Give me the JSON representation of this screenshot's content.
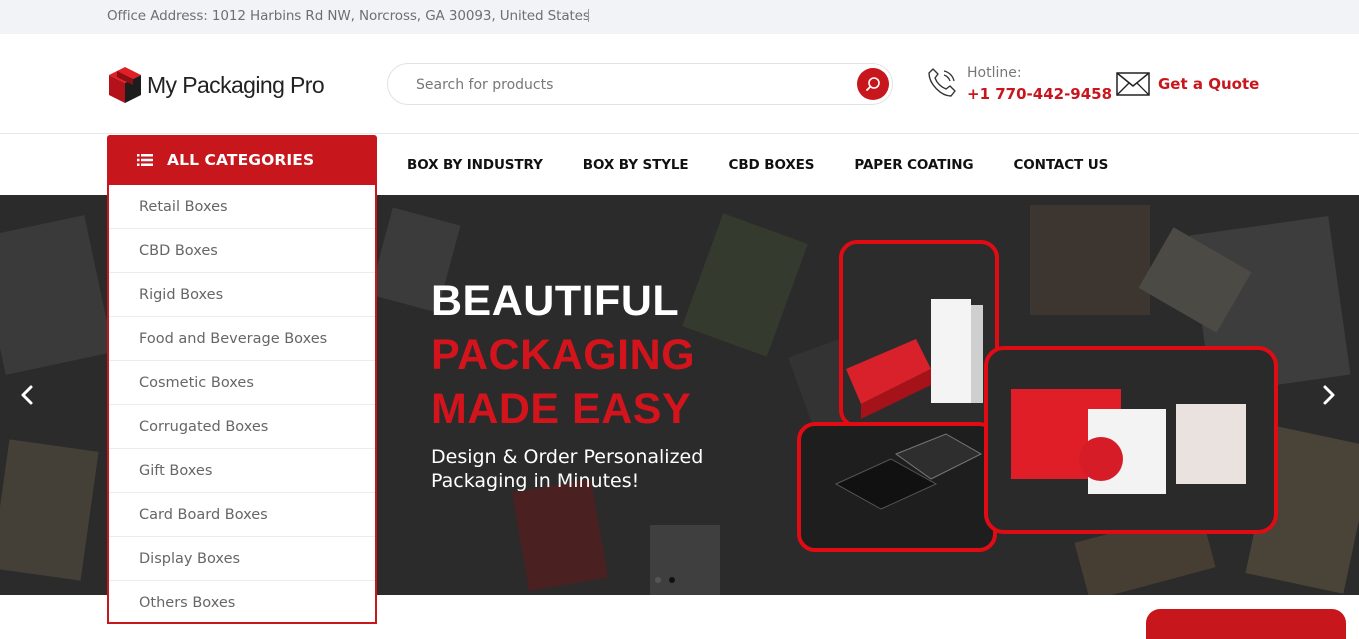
{
  "topbar": {
    "address": "Office Address: 1012 Harbins Rd NW, Norcross, GA 30093, United States"
  },
  "header": {
    "logo_text": "My Packaging Pro",
    "search": {
      "placeholder": "Search for products"
    },
    "hotline": {
      "label": "Hotline:",
      "number": "+1 770-442-9458"
    },
    "quote": {
      "label": "Get a Quote"
    }
  },
  "nav": {
    "items": [
      "BOX BY INDUSTRY",
      "BOX BY STYLE",
      "CBD BOXES",
      "PAPER COATING",
      "CONTACT US"
    ]
  },
  "categories": {
    "title": "ALL CATEGORIES",
    "items": [
      "Retail Boxes",
      "CBD Boxes",
      "Rigid Boxes",
      "Food and Beverage Boxes",
      "Cosmetic Boxes",
      "Corrugated Boxes",
      "Gift Boxes",
      "Card Board Boxes",
      "Display Boxes",
      "Others Boxes"
    ]
  },
  "hero": {
    "line1": "BEAUTIFUL",
    "line2": "PACKAGING",
    "line3": "MADE EASY",
    "subtitle": "Design & Order Personalized Packaging in Minutes!",
    "slide_count": 2,
    "active_slide": 2
  },
  "colors": {
    "accent": "#c8161d",
    "hero_bg": "#2a2a2a",
    "topbar_bg": "#f2f3f7"
  },
  "icons": [
    "menu-icon",
    "search-icon",
    "phone-icon",
    "mail-icon",
    "chevron-left-icon",
    "chevron-right-icon"
  ]
}
